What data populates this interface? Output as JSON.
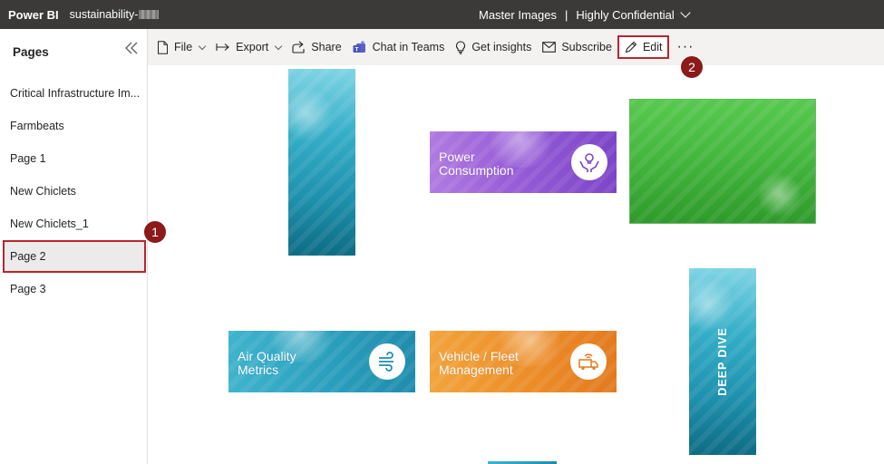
{
  "header": {
    "brand": "Power BI",
    "report_name": "sustainability-",
    "workspace": "Master Images",
    "separator": "|",
    "sensitivity": "Highly Confidential"
  },
  "pages_pane": {
    "title": "Pages",
    "items": [
      {
        "label": "Critical Infrastructure Im...",
        "selected": false
      },
      {
        "label": "Farmbeats",
        "selected": false
      },
      {
        "label": "Page 1",
        "selected": false
      },
      {
        "label": "New Chiclets",
        "selected": false
      },
      {
        "label": "New Chiclets_1",
        "selected": false
      },
      {
        "label": "Page 2",
        "selected": true
      },
      {
        "label": "Page 3",
        "selected": false
      }
    ]
  },
  "toolbar": {
    "file": "File",
    "export": "Export",
    "share": "Share",
    "chat": "Chat in Teams",
    "insights": "Get insights",
    "subscribe": "Subscribe",
    "edit": "Edit",
    "more": "···"
  },
  "tiles": {
    "power": {
      "line1": "Power",
      "line2": "Consumption",
      "icon": "hands-lightbulb-icon"
    },
    "air": {
      "line1": "Air Quality",
      "line2": "Metrics",
      "icon": "wind-icon"
    },
    "vehicle": {
      "line1": "Vehicle / Fleet",
      "line2": "Management",
      "icon": "truck-icon"
    },
    "deep_dive": {
      "label": "DEEP DIVE"
    }
  },
  "callouts": {
    "one": "1",
    "two": "2"
  },
  "colors": {
    "header_bg": "#3b3a39",
    "highlight": "#b8252f",
    "callout": "#8b1a1a",
    "toolbar_bg": "#f3f2f1"
  }
}
